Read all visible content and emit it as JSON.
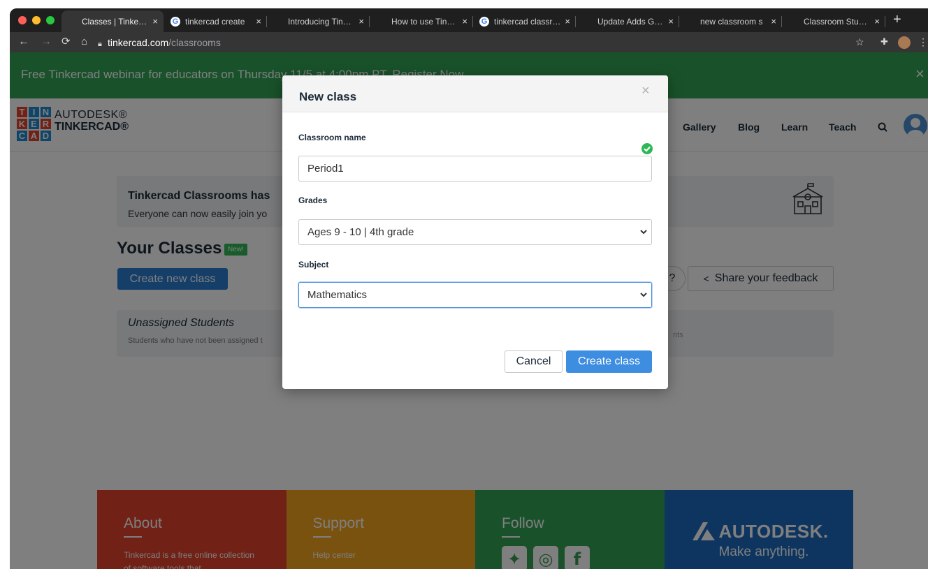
{
  "browser": {
    "tabs": [
      {
        "title": "Classes | Tinkercad",
        "favicon": "tinkercad",
        "active": true
      },
      {
        "title": "tinkercad create",
        "favicon": "google",
        "active": false
      },
      {
        "title": "Introducing Tinkercad",
        "favicon": "tinkercad",
        "active": false
      },
      {
        "title": "How to use Tinkercad",
        "favicon": "tinkercad",
        "active": false
      },
      {
        "title": "tinkercad classroom",
        "favicon": "google",
        "active": false
      },
      {
        "title": "Update Adds Google",
        "favicon": "tinkercad",
        "active": false
      },
      {
        "title": "new classroom s",
        "favicon": "tinkercad",
        "active": false
      },
      {
        "title": "Classroom Student",
        "favicon": "tinkercad",
        "active": false
      }
    ],
    "new_tab": "+",
    "close_glyph": "×",
    "url_host": "tinkercad.com",
    "url_path": "/classrooms"
  },
  "banner": {
    "text": "Free Tinkercad webinar for educators on Thursday 11/5 at 4:00pm PT. Register Now",
    "close": "×"
  },
  "header": {
    "logo_letters": [
      "T",
      "I",
      "N",
      "K",
      "E",
      "R",
      "C",
      "A",
      "D"
    ],
    "logo_colors": [
      "#e2432a",
      "#1c8bd1",
      "#1c8bd1",
      "#e2432a",
      "#1c8bd1",
      "#e2432a",
      "#1c8bd1",
      "#e2432a",
      "#1c8bd1"
    ],
    "brand_top": "AUTODESK®",
    "brand_bottom": "TINKERCAD®",
    "nav": [
      "Gallery",
      "Blog",
      "Learn",
      "Teach"
    ],
    "search_icon": "magnifier"
  },
  "main": {
    "announcement_title": "Tinkercad Classrooms has",
    "announcement_text": "Everyone can now easily join yo",
    "your_classes": "Your Classes",
    "new_badge": "New!",
    "create_class": "Create new class",
    "help_glyph": "?",
    "share_feedback": "Share your feedback",
    "unassigned_title": "Unassigned Students",
    "unassigned_text": "Students who have not been assigned t",
    "unassigned_tail": "nts"
  },
  "footer": {
    "about_title": "About",
    "about_text": "Tinkercad is a free online collection of software tools that",
    "support_title": "Support",
    "support_link": "Help center",
    "follow_title": "Follow",
    "autodesk_name": "AUTODESK.",
    "autodesk_tagline": "Make anything.",
    "colors": {
      "about": "#e2432a",
      "support": "#f4a521",
      "follow": "#33a454",
      "autodesk": "#1c6bc0"
    }
  },
  "modal": {
    "title": "New class",
    "close": "×",
    "name_label": "Classroom name",
    "name_value": "Period1",
    "grades_label": "Grades",
    "grades_value": "Ages 9 - 10 | 4th grade",
    "subject_label": "Subject",
    "subject_value": "Mathematics",
    "cancel": "Cancel",
    "create": "Create class"
  }
}
